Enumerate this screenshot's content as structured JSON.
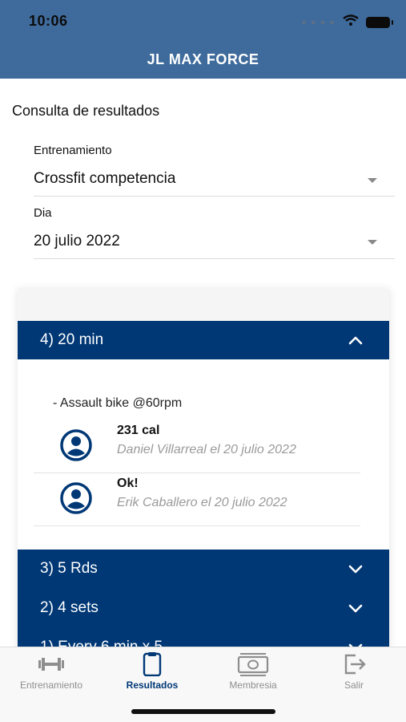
{
  "status_bar": {
    "time": "10:06",
    "signal_icon": "dots-icon",
    "wifi_icon": "wifi-icon",
    "battery_icon": "battery-icon"
  },
  "header": {
    "title": "JL MAX FORCE"
  },
  "page": {
    "title": "Consulta de resultados"
  },
  "filters": {
    "training": {
      "label": "Entrenamiento",
      "value": "Crossfit competencia"
    },
    "day": {
      "label": "Dia",
      "value": "20 julio 2022"
    }
  },
  "workout": {
    "sections": [
      {
        "title": "4) 20 min",
        "expanded": true,
        "exercise": "- Assault bike @60rpm",
        "results": [
          {
            "value": "231 cal",
            "meta": "Daniel Villarreal el 20 julio 2022"
          },
          {
            "value": "Ok!",
            "meta": "Erik Caballero el 20 julio 2022"
          }
        ]
      },
      {
        "title": "3) 5 Rds",
        "expanded": false
      },
      {
        "title": "2) 4 sets",
        "expanded": false
      },
      {
        "title": "1) Every 6 min x 5",
        "expanded": false
      }
    ]
  },
  "tabs": [
    {
      "label": "Entrenamiento",
      "icon": "dumbbell-icon",
      "active": false
    },
    {
      "label": "Resultados",
      "icon": "clipboard-icon",
      "active": true
    },
    {
      "label": "Membresia",
      "icon": "money-icon",
      "active": false
    },
    {
      "label": "Salir",
      "icon": "logout-icon",
      "active": false
    }
  ],
  "colors": {
    "header": "#3f6b9c",
    "accent": "#003876"
  }
}
